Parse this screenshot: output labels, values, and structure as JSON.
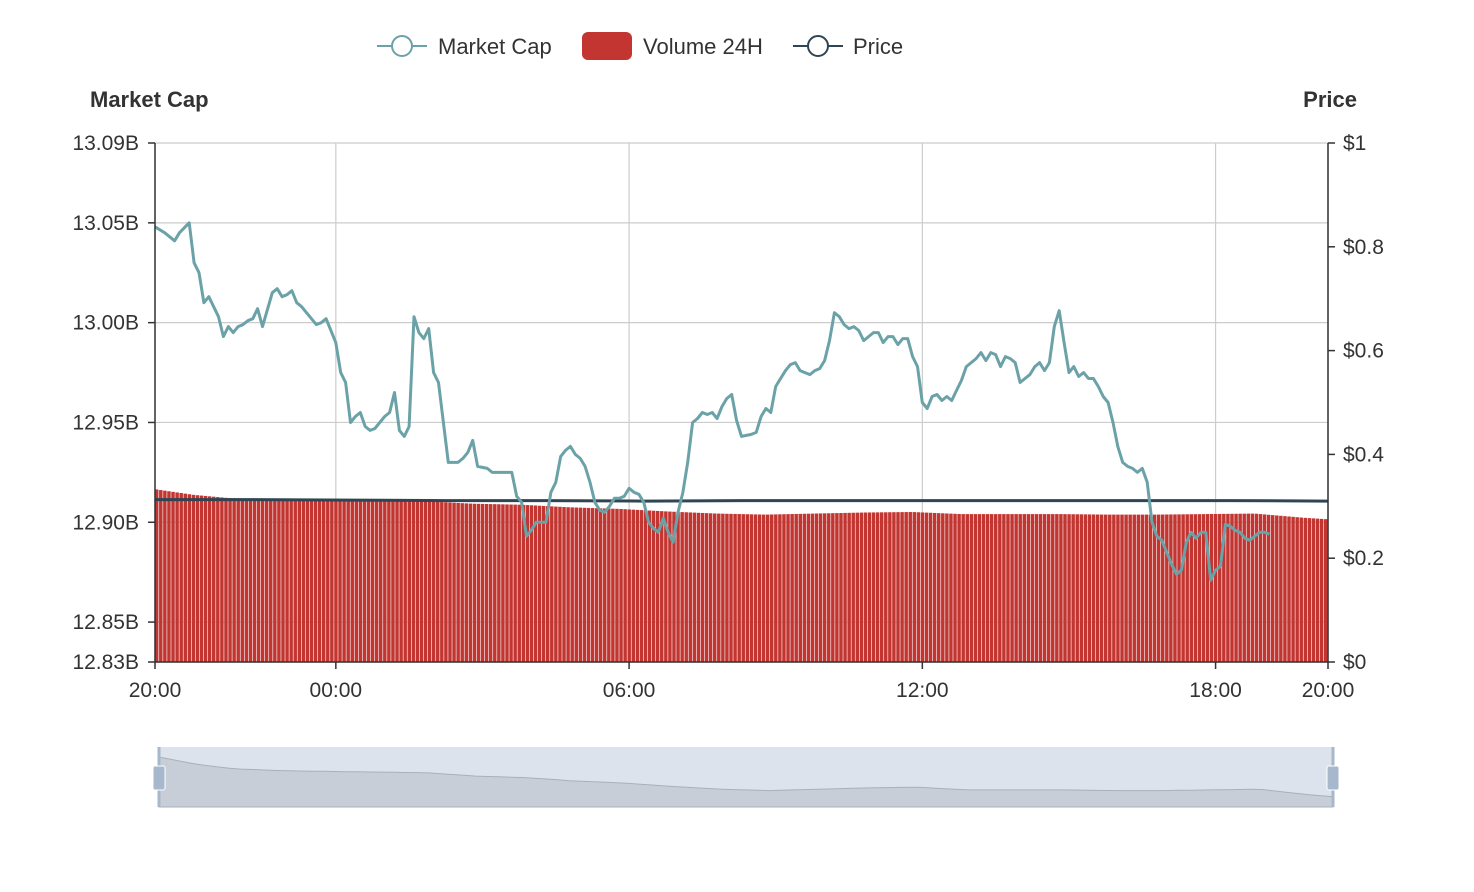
{
  "colors": {
    "market_cap": "#6aa2a8",
    "volume": "#c23531",
    "price": "#2f4554",
    "grid": "#cccccc",
    "axis": "#333333",
    "zoom_bg": "#dde3ec",
    "zoom_handle": "#a7b7cc"
  },
  "legend": {
    "market_cap": "Market Cap",
    "volume": "Volume 24H",
    "price": "Price"
  },
  "chart_data": {
    "type": "line",
    "title": "",
    "x_ticks": [
      "20:00",
      "00:00",
      "06:00",
      "12:00",
      "18:00",
      "20:00"
    ],
    "x_range_hours": [
      0,
      24
    ],
    "x_tick_hours": [
      0,
      3.7,
      9.7,
      15.7,
      21.7,
      24
    ],
    "left_axis": {
      "title": "Market Cap",
      "ticks": [
        "13.09B",
        "13.05B",
        "13.00B",
        "12.95B",
        "12.90B",
        "12.85B",
        "12.83B"
      ],
      "tick_values": [
        13.09,
        13.05,
        13.0,
        12.95,
        12.9,
        12.85,
        12.83
      ],
      "range": [
        12.83,
        13.09
      ]
    },
    "right_axis": {
      "title": "Price",
      "ticks": [
        "$1",
        "$0.8",
        "$0.6",
        "$0.4",
        "$0.2",
        "$0"
      ],
      "tick_values": [
        1,
        0.8,
        0.6,
        0.4,
        0.2,
        0
      ],
      "range": [
        0,
        1
      ]
    },
    "series": [
      {
        "name": "Market Cap",
        "axis": "left",
        "x_hours": [
          0,
          0.2,
          0.4,
          0.5,
          0.7,
          0.8,
          0.9,
          1.0,
          1.1,
          1.3,
          1.4,
          1.5,
          1.6,
          1.7,
          1.8,
          1.9,
          2.0,
          2.1,
          2.2,
          2.4,
          2.5,
          2.6,
          2.7,
          2.8,
          2.9,
          3.0,
          3.1,
          3.3,
          3.4,
          3.5,
          3.7,
          3.8,
          3.9,
          4.0,
          4.1,
          4.2,
          4.3,
          4.4,
          4.5,
          4.7,
          4.8,
          4.9,
          5.0,
          5.1,
          5.2,
          5.3,
          5.4,
          5.5,
          5.6,
          5.7,
          5.8,
          5.9,
          6.0,
          6.2,
          6.3,
          6.4,
          6.5,
          6.6,
          6.8,
          6.9,
          7.0,
          7.1,
          7.2,
          7.3,
          7.4,
          7.5,
          7.6,
          7.7,
          7.8,
          8.0,
          8.1,
          8.2,
          8.3,
          8.4,
          8.5,
          8.6,
          8.7,
          8.8,
          8.9,
          9.0,
          9.1,
          9.2,
          9.3,
          9.4,
          9.5,
          9.6,
          9.7,
          9.8,
          9.9,
          10.0,
          10.1,
          10.2,
          10.3,
          10.4,
          10.5,
          10.6,
          10.7,
          10.8,
          10.9,
          11.0,
          11.1,
          11.2,
          11.3,
          11.4,
          11.5,
          11.6,
          11.7,
          11.8,
          11.9,
          12.0,
          12.2,
          12.3,
          12.4,
          12.5,
          12.6,
          12.7,
          12.8,
          12.9,
          13.0,
          13.1,
          13.2,
          13.3,
          13.4,
          13.5,
          13.6,
          13.7,
          13.8,
          13.9,
          14.0,
          14.1,
          14.2,
          14.3,
          14.4,
          14.5,
          14.6,
          14.7,
          14.8,
          14.9,
          15.0,
          15.1,
          15.2,
          15.3,
          15.4,
          15.5,
          15.6,
          15.7,
          15.8,
          15.9,
          16.0,
          16.1,
          16.2,
          16.3,
          16.4,
          16.5,
          16.6,
          16.7,
          16.8,
          16.9,
          17.0,
          17.1,
          17.2,
          17.3,
          17.4,
          17.5,
          17.6,
          17.7,
          17.8,
          17.9,
          18.0,
          18.1,
          18.2,
          18.3,
          18.4,
          18.5,
          18.6,
          18.7,
          18.8,
          18.9,
          19.0,
          19.1,
          19.2,
          19.3,
          19.4,
          19.5,
          19.6,
          19.7,
          19.8,
          19.9,
          20.0,
          20.1,
          20.2,
          20.3,
          20.4,
          20.5,
          20.6,
          20.7,
          20.8,
          20.9,
          21.0,
          21.1,
          21.2,
          21.3,
          21.4,
          21.5,
          21.6,
          21.7,
          21.8,
          21.9,
          22.0,
          22.1,
          22.2,
          22.3,
          22.4,
          22.5,
          22.6,
          22.7,
          22.8,
          22.9,
          23.0,
          23.1,
          23.2,
          23.3,
          23.4,
          23.5,
          23.6,
          23.7,
          23.8,
          23.9,
          24.0
        ],
        "values": [
          13.048,
          13.045,
          13.041,
          13.045,
          13.05,
          13.03,
          13.025,
          13.01,
          13.013,
          13.003,
          12.993,
          12.998,
          12.995,
          12.998,
          12.999,
          13.001,
          13.002,
          13.007,
          12.998,
          13.015,
          13.017,
          13.013,
          13.014,
          13.016,
          13.01,
          13.008,
          13.005,
          12.999,
          13.0,
          13.002,
          12.99,
          12.975,
          12.97,
          12.95,
          12.953,
          12.955,
          12.948,
          12.946,
          12.947,
          12.953,
          12.955,
          12.965,
          12.946,
          12.943,
          12.948,
          13.003,
          12.995,
          12.992,
          12.997,
          12.975,
          12.97,
          12.95,
          12.93,
          12.93,
          12.932,
          12.935,
          12.941,
          12.928,
          12.927,
          12.925,
          12.925,
          12.925,
          12.925,
          12.925,
          12.913,
          12.91,
          12.893,
          12.896,
          12.9,
          12.9,
          12.915,
          12.92,
          12.933,
          12.936,
          12.938,
          12.934,
          12.932,
          12.928,
          12.92,
          12.91,
          12.906,
          12.905,
          12.908,
          12.912,
          12.912,
          12.913,
          12.917,
          12.915,
          12.914,
          12.91,
          12.9,
          12.897,
          12.895,
          12.902,
          12.895,
          12.89,
          12.905,
          12.915,
          12.93,
          12.95,
          12.952,
          12.955,
          12.954,
          12.955,
          12.952,
          12.958,
          12.962,
          12.964,
          12.951,
          12.943,
          12.944,
          12.945,
          12.953,
          12.957,
          12.955,
          12.968,
          12.972,
          12.976,
          12.979,
          12.98,
          12.976,
          12.975,
          12.974,
          12.976,
          12.977,
          12.981,
          12.991,
          13.005,
          13.003,
          12.999,
          12.997,
          12.998,
          12.996,
          12.991,
          12.993,
          12.995,
          12.995,
          12.99,
          12.993,
          12.993,
          12.989,
          12.992,
          12.992,
          12.983,
          12.978,
          12.96,
          12.957,
          12.963,
          12.964,
          12.961,
          12.963,
          12.961,
          12.966,
          12.971,
          12.978,
          12.98,
          12.982,
          12.985,
          12.981,
          12.985,
          12.984,
          12.978,
          12.983,
          12.982,
          12.98,
          12.97,
          12.972,
          12.974,
          12.978,
          12.98,
          12.976,
          12.98,
          12.998,
          13.006,
          12.99,
          12.975,
          12.978,
          12.973,
          12.975,
          12.972,
          12.972,
          12.968,
          12.963,
          12.96,
          12.95,
          12.938,
          12.93,
          12.928,
          12.927,
          12.925,
          12.927,
          12.92,
          12.9,
          12.893,
          12.891,
          12.885,
          12.879,
          12.874,
          12.876,
          12.89,
          12.895,
          12.892,
          12.895,
          12.895,
          12.871,
          12.876,
          12.878,
          12.899,
          12.898,
          12.896,
          12.895,
          12.892,
          12.891,
          12.893,
          12.895,
          12.895,
          12.894
        ]
      },
      {
        "name": "Price",
        "axis": "right",
        "x_hours": [
          0,
          2,
          4,
          6,
          8,
          10,
          12,
          14,
          16,
          18,
          20,
          22,
          24
        ],
        "values": [
          0.313,
          0.313,
          0.312,
          0.311,
          0.311,
          0.31,
          0.311,
          0.311,
          0.311,
          0.311,
          0.311,
          0.311,
          0.31
        ]
      },
      {
        "name": "Volume 24H",
        "axis": "right",
        "type": "bar",
        "x_hours": [
          0,
          0.8,
          1.5,
          2.5,
          3.5,
          4.5,
          5.5,
          6.5,
          7.5,
          8.5,
          9.5,
          10.5,
          11.5,
          12.5,
          13.5,
          14.5,
          15.5,
          16.5,
          17.5,
          18.5,
          19.5,
          20.5,
          21.5,
          22.5,
          23.5,
          24.0
        ],
        "values": [
          0.333,
          0.322,
          0.316,
          0.313,
          0.312,
          0.311,
          0.31,
          0.305,
          0.303,
          0.298,
          0.295,
          0.29,
          0.286,
          0.284,
          0.286,
          0.288,
          0.289,
          0.285,
          0.285,
          0.285,
          0.284,
          0.284,
          0.285,
          0.286,
          0.278,
          0.275
        ]
      }
    ],
    "legend_position": "top-center",
    "grid": true
  }
}
